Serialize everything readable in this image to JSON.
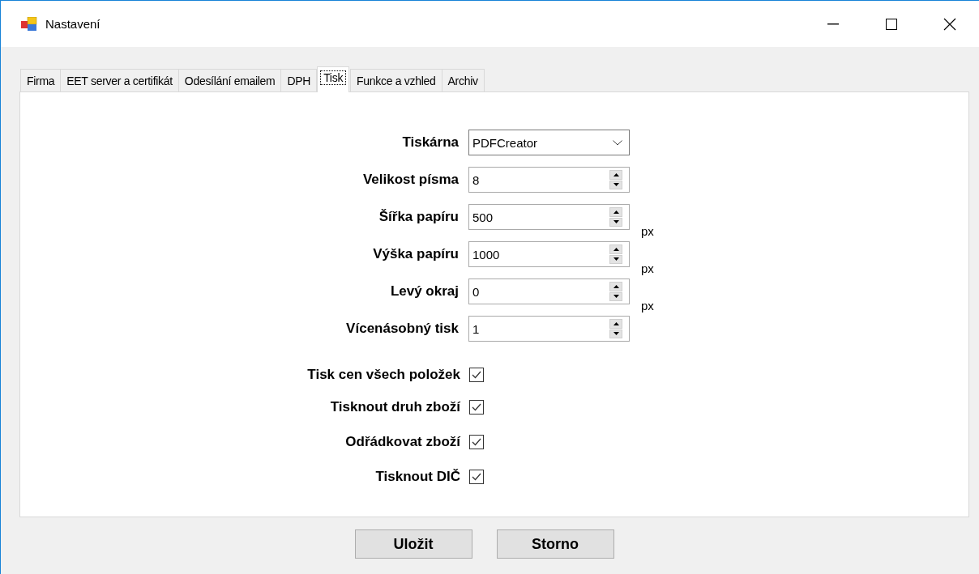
{
  "window": {
    "title": "Nastavení"
  },
  "tabs": [
    {
      "label": "Firma",
      "selected": false
    },
    {
      "label": "EET server a certifikát",
      "selected": false
    },
    {
      "label": "Odesílání emailem",
      "selected": false
    },
    {
      "label": "DPH",
      "selected": false
    },
    {
      "label": "Tisk",
      "selected": true
    },
    {
      "label": "Funkce a vzhled",
      "selected": false
    },
    {
      "label": "Archiv",
      "selected": false
    }
  ],
  "fields": [
    {
      "kind": "dropdown",
      "label": "Tiskárna",
      "value": "PDFCreator"
    },
    {
      "kind": "spinner",
      "label": "Velikost písma",
      "value": "8"
    },
    {
      "kind": "spinner",
      "label": "Šířka papíru",
      "value": "500",
      "unit": "px"
    },
    {
      "kind": "spinner",
      "label": "Výška papíru",
      "value": "1000",
      "unit": "px"
    },
    {
      "kind": "spinner",
      "label": "Levý okraj",
      "value": "0",
      "unit": "px"
    },
    {
      "kind": "spinner",
      "label": "Vícenásobný tisk",
      "value": "1"
    }
  ],
  "checkboxes": [
    {
      "label": "Tisk cen všech položek",
      "checked": true
    },
    {
      "label": "Tisknout druh zboží",
      "checked": true
    },
    {
      "label": "Odřádkovat zboží",
      "checked": true
    },
    {
      "label": "Tisknout DIČ",
      "checked": true
    }
  ],
  "buttons": [
    "Uložit",
    "Storno"
  ]
}
